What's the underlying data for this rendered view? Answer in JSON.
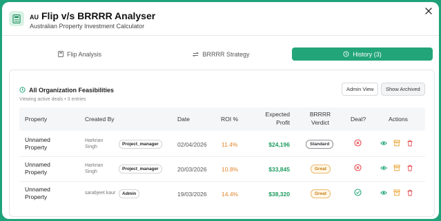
{
  "header": {
    "flag": "AU",
    "title": "Flip v/s BRRRR Analyser",
    "subtitle": "Australian Property Investment Calculator",
    "app_icon": "calculator-icon",
    "close_icon": "close-icon"
  },
  "tabs": [
    {
      "label": "Flip Analysis",
      "icon": "calculator-icon",
      "active": false
    },
    {
      "label": "BRRRR Strategy",
      "icon": "swap-icon",
      "active": false
    },
    {
      "label": "History (3)",
      "icon": "history-icon",
      "active": true
    }
  ],
  "panel": {
    "title": "All Organization Feasibilities",
    "subtitle": "Viewing active deals • 3 entries",
    "admin_view_label": "Admin View",
    "show_archived_label": "Show Archived"
  },
  "table": {
    "headers": {
      "property": "Property",
      "created_by": "Created By",
      "date": "Date",
      "roi": "ROI %",
      "expected_profit_1": "Expected",
      "expected_profit_2": "Profit",
      "brrrr_verdict_1": "BRRRR",
      "brrrr_verdict_2": "Verdict",
      "deal": "Deal?",
      "actions": "Actions"
    },
    "rows": [
      {
        "property_1": "Unnamed",
        "property_2": "Property",
        "creator_1": "Harkrian",
        "creator_2": "Singh",
        "role": "Project_manager",
        "date": "02/04/2026",
        "roi": "11.4%",
        "profit": "$24,196",
        "verdict": "Standard",
        "deal": "no"
      },
      {
        "property_1": "Unnamed",
        "property_2": "Property",
        "creator_1": "Harkrian",
        "creator_2": "Singh",
        "role": "Project_manager",
        "date": "20/03/2026",
        "roi": "10.8%",
        "profit": "$33,845",
        "verdict": "Great",
        "deal": "no"
      },
      {
        "property_1": "Unnamed",
        "property_2": "Property",
        "creator_1": "sarabjeet kaur",
        "creator_2": "",
        "role": "Admin",
        "date": "19/03/2026",
        "roi": "14.4%",
        "profit": "$38,320",
        "verdict": "Great",
        "deal": "yes"
      }
    ]
  },
  "colors": {
    "accent": "#22a578",
    "roi": "#e0852a",
    "profit": "#1e9b5f",
    "deal_no": "#e5484d",
    "deal_yes": "#22a578"
  }
}
